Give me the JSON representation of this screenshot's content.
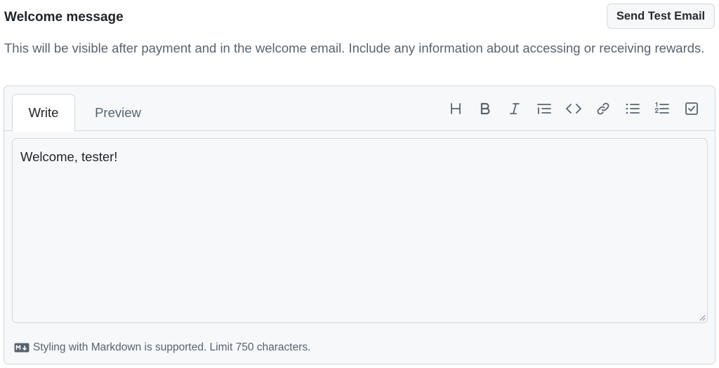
{
  "section": {
    "title": "Welcome message",
    "send_test_label": "Send Test Email",
    "description": "This will be visible after payment and in the welcome email. Include any information about accessing or receiving rewards."
  },
  "editor": {
    "tabs": [
      {
        "label": "Write",
        "active": true
      },
      {
        "label": "Preview",
        "active": false
      }
    ],
    "toolbar": [
      {
        "icon": "heading-icon"
      },
      {
        "icon": "bold-icon"
      },
      {
        "icon": "italic-icon"
      },
      {
        "icon": "quote-icon"
      },
      {
        "icon": "code-icon"
      },
      {
        "icon": "link-icon"
      },
      {
        "icon": "unordered-list-icon"
      },
      {
        "icon": "ordered-list-icon"
      },
      {
        "icon": "task-list-icon"
      }
    ],
    "content": "Welcome, tester!",
    "footer_note": "Styling with Markdown is supported. Limit 750 characters."
  },
  "colors": {
    "text": "#1f2328",
    "muted": "#59636e",
    "border": "#d1d9e0",
    "panel_bg": "#f6f8fa"
  }
}
